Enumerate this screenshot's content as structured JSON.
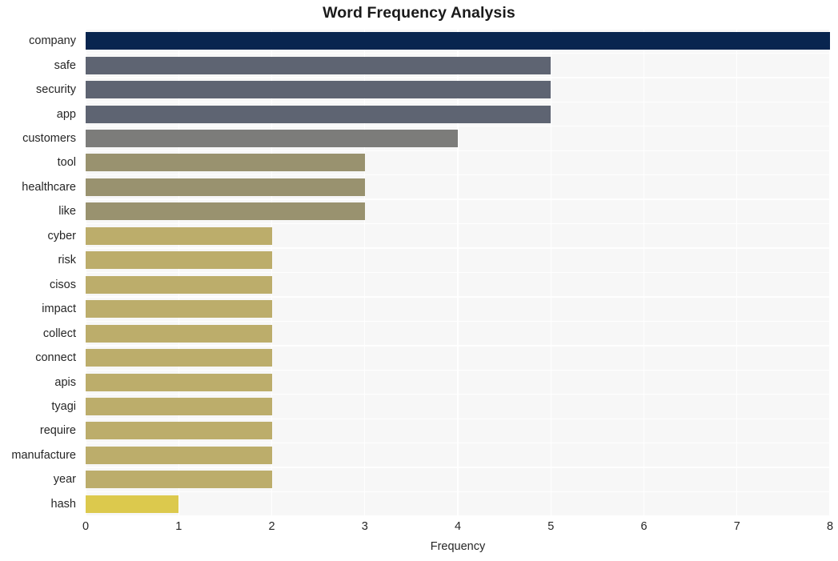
{
  "chart_data": {
    "type": "bar",
    "orientation": "horizontal",
    "title": "Word Frequency Analysis",
    "xlabel": "Frequency",
    "ylabel": "",
    "categories": [
      "company",
      "safe",
      "security",
      "app",
      "customers",
      "tool",
      "healthcare",
      "like",
      "cyber",
      "risk",
      "cisos",
      "impact",
      "collect",
      "connect",
      "apis",
      "tyagi",
      "require",
      "manufacture",
      "year",
      "hash"
    ],
    "values": [
      8,
      5,
      5,
      5,
      4,
      3,
      3,
      3,
      2,
      2,
      2,
      2,
      2,
      2,
      2,
      2,
      2,
      2,
      2,
      1
    ],
    "bar_colors": [
      "#08254f",
      "#5e6472",
      "#5e6472",
      "#5e6472",
      "#7c7c7a",
      "#99926f",
      "#99926f",
      "#99926f",
      "#bcad6b",
      "#bcad6b",
      "#bcad6b",
      "#bcad6b",
      "#bcad6b",
      "#bcad6b",
      "#bcad6b",
      "#bcad6b",
      "#bcad6b",
      "#bcad6b",
      "#bcad6b",
      "#dcc94d"
    ],
    "xlim": [
      0,
      8
    ],
    "xticks": [
      0,
      1,
      2,
      3,
      4,
      5,
      6,
      7,
      8
    ],
    "xtick_labels": [
      "0",
      "1",
      "2",
      "3",
      "4",
      "5",
      "6",
      "7",
      "8"
    ],
    "grid": true,
    "grid_color": "#ffffff",
    "plot_background": "#f7f7f7",
    "figure_background": "#ffffff",
    "legend": null
  }
}
